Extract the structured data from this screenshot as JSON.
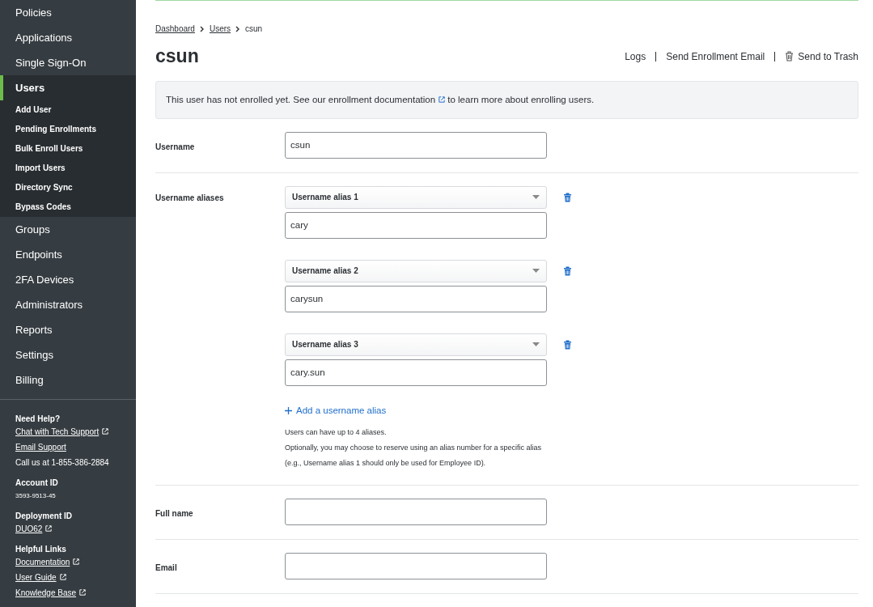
{
  "sidebar": {
    "nav": [
      {
        "label": "Policies",
        "selected": false
      },
      {
        "label": "Applications",
        "selected": false
      },
      {
        "label": "Single Sign-On",
        "selected": false
      },
      {
        "label": "Users",
        "selected": true,
        "children": [
          {
            "label": "Add User"
          },
          {
            "label": "Pending Enrollments"
          },
          {
            "label": "Bulk Enroll Users"
          },
          {
            "label": "Import Users"
          },
          {
            "label": "Directory Sync"
          },
          {
            "label": "Bypass Codes"
          }
        ]
      },
      {
        "label": "Groups",
        "selected": false
      },
      {
        "label": "Endpoints",
        "selected": false
      },
      {
        "label": "2FA Devices",
        "selected": false
      },
      {
        "label": "Administrators",
        "selected": false
      },
      {
        "label": "Reports",
        "selected": false
      },
      {
        "label": "Settings",
        "selected": false
      },
      {
        "label": "Billing",
        "selected": false
      }
    ],
    "help": [
      {
        "heading": "Need Help?",
        "items": [
          {
            "kind": "link",
            "text": "Chat with Tech Support",
            "external": true
          },
          {
            "kind": "link",
            "text": "Email Support",
            "external": false
          },
          {
            "kind": "text",
            "text": "Call us at 1-855-386-2884"
          }
        ]
      },
      {
        "heading": "Account ID",
        "items": [
          {
            "kind": "small",
            "text": "3593-9513-45"
          }
        ]
      },
      {
        "heading": "Deployment ID",
        "items": [
          {
            "kind": "link",
            "text": "DUO62",
            "external": true
          }
        ]
      },
      {
        "heading": "Helpful Links",
        "items": [
          {
            "kind": "link",
            "text": "Documentation",
            "external": true
          },
          {
            "kind": "link",
            "text": "User Guide",
            "external": true
          },
          {
            "kind": "link",
            "text": "Knowledge Base",
            "external": true
          }
        ]
      }
    ]
  },
  "breadcrumbs": [
    {
      "text": "Dashboard",
      "link": true
    },
    {
      "text": "Users",
      "link": true
    },
    {
      "text": "csun",
      "link": false
    }
  ],
  "title": "csun",
  "actions": [
    {
      "text": "Logs",
      "icon": false
    },
    {
      "text": "Send Enrollment Email",
      "icon": false
    },
    {
      "text": "Send to Trash",
      "icon": true
    }
  ],
  "notice": {
    "before": "This user has not enrolled yet. See our",
    "link": "enrollment documentation",
    "after": "to learn more about enrolling users."
  },
  "form": [
    {
      "kind": "text",
      "label": "Username",
      "value": "csun"
    },
    {
      "kind": "aliases",
      "label": "Username aliases",
      "aliases": [
        {
          "slot": "Username alias 1",
          "value": "cary"
        },
        {
          "slot": "Username alias 2",
          "value": "carysun"
        },
        {
          "slot": "Username alias 3",
          "value": "cary.sun"
        }
      ],
      "add_link": "Add a username alias",
      "notes": [
        "Users can have up to 4 aliases.",
        "Optionally, you may choose to reserve using an alias number for a specific alias",
        "(e.g., Username alias 1 should only be used for Employee ID)."
      ]
    },
    {
      "kind": "text",
      "label": "Full name"
    },
    {
      "kind": "text",
      "label": "Email"
    }
  ]
}
